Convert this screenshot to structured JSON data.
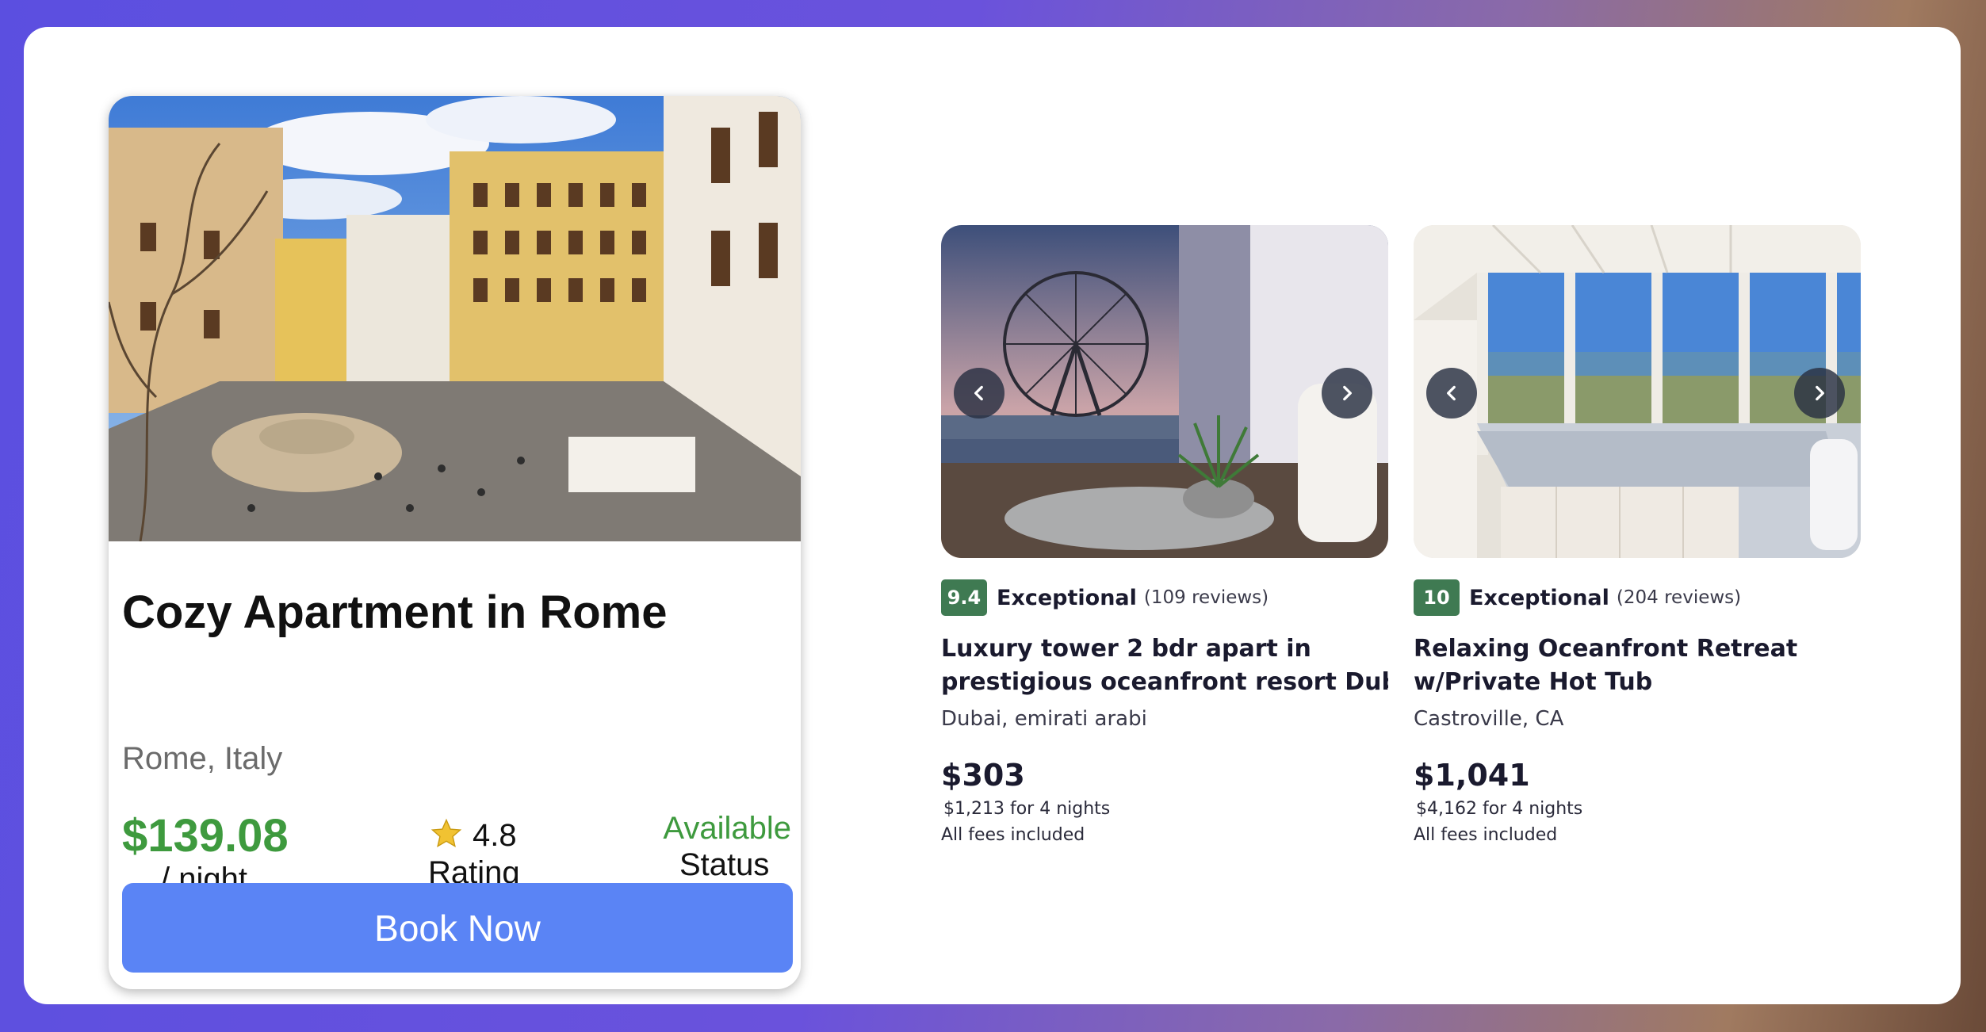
{
  "featured": {
    "title": "Cozy Apartment in Rome",
    "location": "Rome, Italy",
    "price": "$139.08",
    "price_unit": "/ night",
    "rating": "4.8",
    "rating_label": "Rating",
    "status": "Available",
    "status_label": "Status",
    "book_label": "Book Now",
    "icons": {
      "rating": "star-icon"
    },
    "colors": {
      "price": "#3e9a3e",
      "status": "#3e9a3e",
      "button": "#5a84f5"
    }
  },
  "listings": [
    {
      "score": "9.4",
      "score_label": "Exceptional",
      "reviews": "(109 reviews)",
      "title_line1": "Luxury tower 2 bdr apart in",
      "title_line2": "prestigious oceanfront resort Dub...",
      "location": "Dubai, emirati arabi",
      "price": "$303",
      "total": "$1,213 for 4 nights",
      "fees": "All fees included"
    },
    {
      "score": "10",
      "score_label": "Exceptional",
      "reviews": "(204 reviews)",
      "title_line1": "Relaxing Oceanfront Retreat",
      "title_line2": "w/Private Hot Tub",
      "location": "Castroville, CA",
      "price": "$1,041",
      "total": "$4,162 for 4 nights",
      "fees": "All fees included"
    }
  ],
  "colors": {
    "score_badge": "#3f7a52",
    "nav_button": "#283042"
  }
}
